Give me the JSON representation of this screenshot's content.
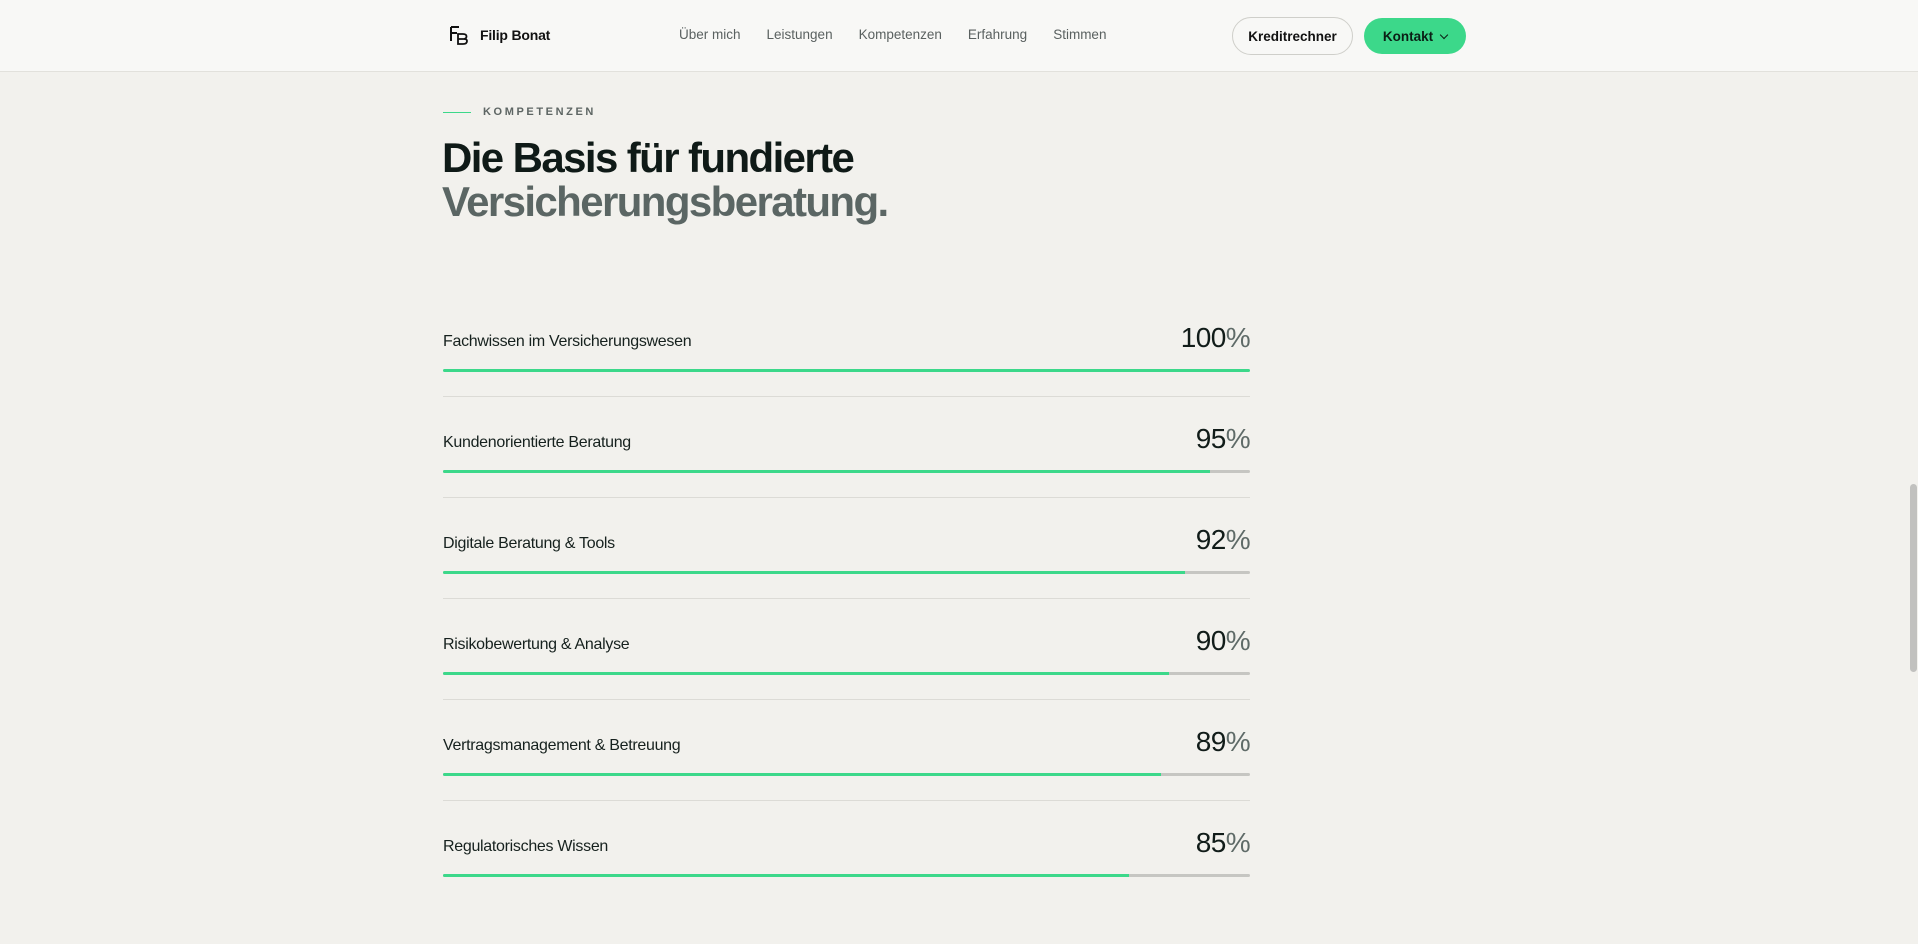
{
  "header": {
    "brand_name": "Filip Bonat",
    "logo_icon": "fb-monogram-icon",
    "nav": [
      {
        "label": "Über mich"
      },
      {
        "label": "Leistungen"
      },
      {
        "label": "Kompetenzen"
      },
      {
        "label": "Erfahrung"
      },
      {
        "label": "Stimmen"
      }
    ],
    "calculator_label": "Kreditrechner",
    "contact_label": "Kontakt",
    "contact_icon": "chevron-down-icon"
  },
  "section": {
    "eyebrow": "KOMPETENZEN",
    "title_line_1": "Die Basis für fundierte",
    "title_line_2": "Versicherungsberatung."
  },
  "skills": [
    {
      "label": "Fachwissen im Versicherungswesen",
      "value": "100",
      "unit": "%",
      "fraction": 1.0
    },
    {
      "label": "Kundenorientierte Beratung",
      "value": "95",
      "unit": "%",
      "fraction": 0.95
    },
    {
      "label": "Digitale Beratung & Tools",
      "value": "92",
      "unit": "%",
      "fraction": 0.92
    },
    {
      "label": "Risikobewertung & Analyse",
      "value": "90",
      "unit": "%",
      "fraction": 0.9
    },
    {
      "label": "Vertragsmanagement & Betreuung",
      "value": "89",
      "unit": "%",
      "fraction": 0.89
    },
    {
      "label": "Regulatorisches Wissen",
      "value": "85",
      "unit": "%",
      "fraction": 0.85
    }
  ],
  "colors": {
    "accent": "#3cd88a",
    "background": "#f2f1ed",
    "track": "#c6c6c2",
    "heading": "#0f1a17",
    "heading_muted": "#5b6664"
  }
}
